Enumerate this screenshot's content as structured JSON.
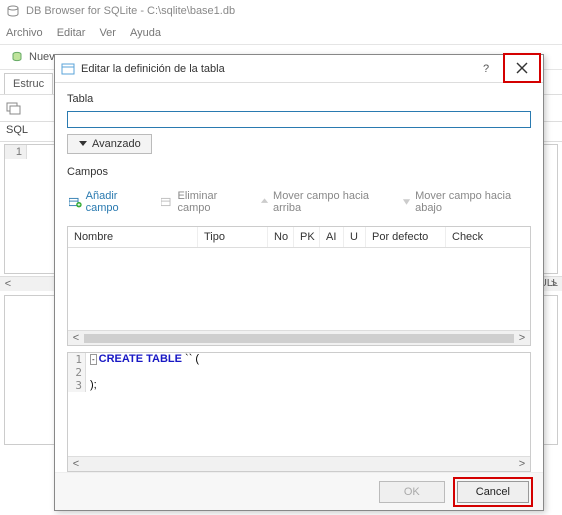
{
  "window": {
    "title": "DB Browser for SQLite - C:\\sqlite\\base1.db"
  },
  "menu": {
    "file": "Archivo",
    "edit": "Editar",
    "view": "Ver",
    "help": "Ayuda"
  },
  "toolbar": {
    "new": "Nuev"
  },
  "tabs": {
    "structure": "Estruc"
  },
  "panel": {
    "sql": "SQL"
  },
  "side": {
    "null": "s: NULL"
  },
  "modal": {
    "title": "Editar la definición de la tabla",
    "tableLabel": "Tabla",
    "tableValue": "",
    "advanced": "Avanzado",
    "camposLabel": "Campos",
    "fieldsBar": {
      "add": "Añadir campo",
      "remove": "Eliminar campo",
      "moveUp": "Mover campo hacia arriba",
      "moveDown": "Mover campo hacia abajo"
    },
    "columns": {
      "name": "Nombre",
      "type": "Tipo",
      "no": "No",
      "pk": "PK",
      "ai": "AI",
      "u": "U",
      "default": "Por defecto",
      "check": "Check"
    },
    "sql": {
      "l1a": "CREATE TABLE",
      "l1b": " `` (",
      "l2": "",
      "l3": ");"
    },
    "buttons": {
      "ok": "OK",
      "cancel": "Cancel"
    }
  }
}
